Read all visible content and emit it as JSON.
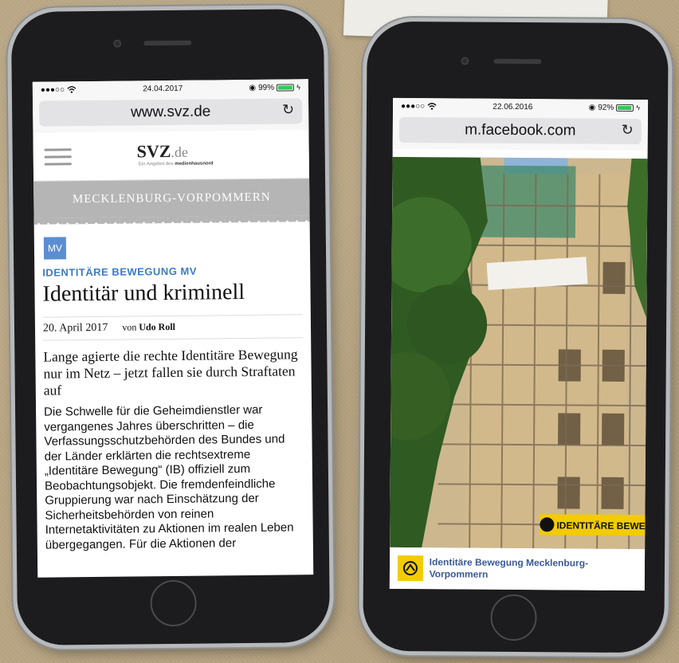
{
  "left_phone": {
    "status": {
      "signal": "●●●○○",
      "date": "24.04.2017",
      "battery": "99%",
      "battery_fraction": 0.99
    },
    "url": "www.svz.de",
    "logo": {
      "main": "SVZ",
      "suffix": ".de",
      "sub_text": "Ein Angebot des",
      "sub_brand": "medienhausnord"
    },
    "region": "MECKLENBURG-VORPOMMERN",
    "badge": "MV",
    "kicker": "IDENTITÄRE BEWEGUNG MV",
    "headline": "Identitär und kriminell",
    "date": "20. April 2017",
    "author_prefix": "von",
    "author": "Udo Roll",
    "lead": "Lange agierte die rechte Identitäre Bewegung nur im Netz – jetzt fallen sie durch Straftaten auf",
    "body": "Die Schwelle für die Geheimdienstler war vergangenes Jahres überschritten – die Verfassungsschutzbehörden des Bundes und der Länder erklärten die rechtsextreme „Identitäre Bewegung“ (IB) offiziell zum Beobachtungsobjekt. Die fremdenfeindliche Gruppierung war nach Einschätzung der Sicherheitsbehörden von reinen Internetaktivitäten zu Aktionen im realen Leben übergegangen. Für die Aktionen der"
  },
  "right_phone": {
    "status": {
      "signal": "●●●○○",
      "date": "22.06.2016",
      "battery": "92%",
      "battery_fraction": 0.92
    },
    "url": "m.facebook.com",
    "banner_text": "IDENTITÄRE BEWEGUNG",
    "caption_name": "Identitäre Bewegung Mecklenburg-Vorpommern"
  },
  "colors": {
    "kicker": "#3c7bc7",
    "facebook_link": "#3b5998",
    "ib_yellow": "#f2cc00",
    "battery": "#34c759"
  }
}
